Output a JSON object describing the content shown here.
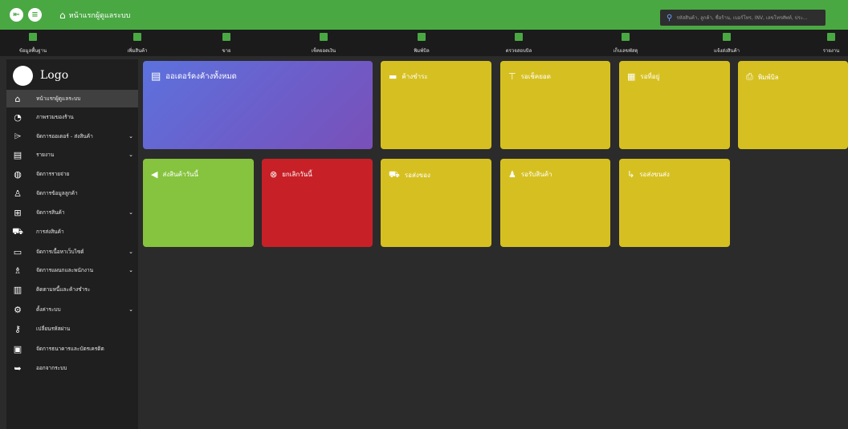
{
  "topbar": {
    "home_label": "หน้าแรกผู้ดูแลระบบ",
    "search_placeholder": "รหัสสินค้า, ลูกค้า, ชื่อร้าน, เบอร์โทร, INV, เลขโทรศัพท์, ประ...",
    "color": "#4aa843"
  },
  "menubar": {
    "items": [
      {
        "label": "ข้อมูลพื้นฐาน",
        "icon": "database-icon"
      },
      {
        "label": "เพิ่มสินค้า",
        "icon": "box-icon"
      },
      {
        "label": "ขาย",
        "icon": "cart-icon"
      },
      {
        "label": "เช็คยอดเงิน",
        "icon": "money-icon"
      },
      {
        "label": "พิมพ์บิล",
        "icon": "printer-icon"
      },
      {
        "label": "ตรวจสอบบิล",
        "icon": "bill-icon"
      },
      {
        "label": "เก็บเลขพัสดุ",
        "icon": "barcode-icon"
      },
      {
        "label": "แจ้งส่งสินค้า",
        "icon": "truck-icon"
      },
      {
        "label": "รายงาน",
        "icon": "report-icon"
      }
    ]
  },
  "sidebar": {
    "logo_text": "Logo",
    "items": [
      {
        "label": "หน้าแรกผู้ดูแลระบบ",
        "icon": "home-icon",
        "chevron": false,
        "active": true
      },
      {
        "label": "ภาพรวมของร้าน",
        "icon": "chart-icon",
        "chevron": false
      },
      {
        "label": "จัดการออเดอร์ - ส่งสินค้า",
        "icon": "tag-icon",
        "chevron": true
      },
      {
        "label": "รายงาน",
        "icon": "document-icon",
        "chevron": true
      },
      {
        "label": "จัดการรายจ่าย",
        "icon": "money-bag-icon",
        "chevron": false
      },
      {
        "label": "จัดการข้อมูลลูกค้า",
        "icon": "user-icon",
        "chevron": false
      },
      {
        "label": "จัดการสินค้า",
        "icon": "gift-icon",
        "chevron": true
      },
      {
        "label": "การส่งสินค้า",
        "icon": "truck-icon",
        "chevron": false
      },
      {
        "label": "จัดการเนื้อหาเว็บไซต์",
        "icon": "monitor-icon",
        "chevron": true
      },
      {
        "label": "จัดการแผนกและพนักงาน",
        "icon": "team-icon",
        "chevron": true
      },
      {
        "label": "ติดตามหนี้และค้างชำระ",
        "icon": "ledger-icon",
        "chevron": false
      },
      {
        "label": "ตั้งค่าระบบ",
        "icon": "gear-icon",
        "chevron": true
      },
      {
        "label": "เปลี่ยนรหัสผ่าน",
        "icon": "key-icon",
        "chevron": false
      },
      {
        "label": "จัดการธนาคารและบัตรเครดิต",
        "icon": "card-icon",
        "chevron": false
      },
      {
        "label": "ออกจากระบบ",
        "icon": "logout-icon",
        "chevron": false
      }
    ]
  },
  "tiles": {
    "pending_orders": {
      "label": "ออเดอร์คงค้างทั้งหมด",
      "icon": "clipboard-icon",
      "color": "#6366d6"
    },
    "awaiting_payment": {
      "label": "ค้างชำระ",
      "icon": "credit-card-icon",
      "color": "#d6c021"
    },
    "awaiting_check": {
      "label": "รอเช็คยอด",
      "icon": "pin-icon",
      "color": "#d6c021"
    },
    "awaiting_address": {
      "label": "รอที่อยู่",
      "icon": "address-icon",
      "color": "#d6c021"
    },
    "print_bill": {
      "label": "พิมพ์บิล",
      "icon": "printer-icon",
      "color": "#d6c021"
    },
    "shipped_today": {
      "label": "ส่งสินค้าวันนี้",
      "icon": "send-icon",
      "color": "#86c33e"
    },
    "cancelled_today": {
      "label": "ยกเลิกวันนี้",
      "icon": "cancel-icon",
      "color": "#c72127"
    },
    "awaiting_shipping": {
      "label": "รอส่งของ",
      "icon": "delivery-truck-icon",
      "color": "#d6c021"
    },
    "awaiting_receipt": {
      "label": "รอรับสินค้า",
      "icon": "receive-user-icon",
      "color": "#d6c021"
    },
    "awaiting_delivery": {
      "label": "รอส่งขนส่ง",
      "icon": "dolly-icon",
      "color": "#d6c021"
    }
  }
}
